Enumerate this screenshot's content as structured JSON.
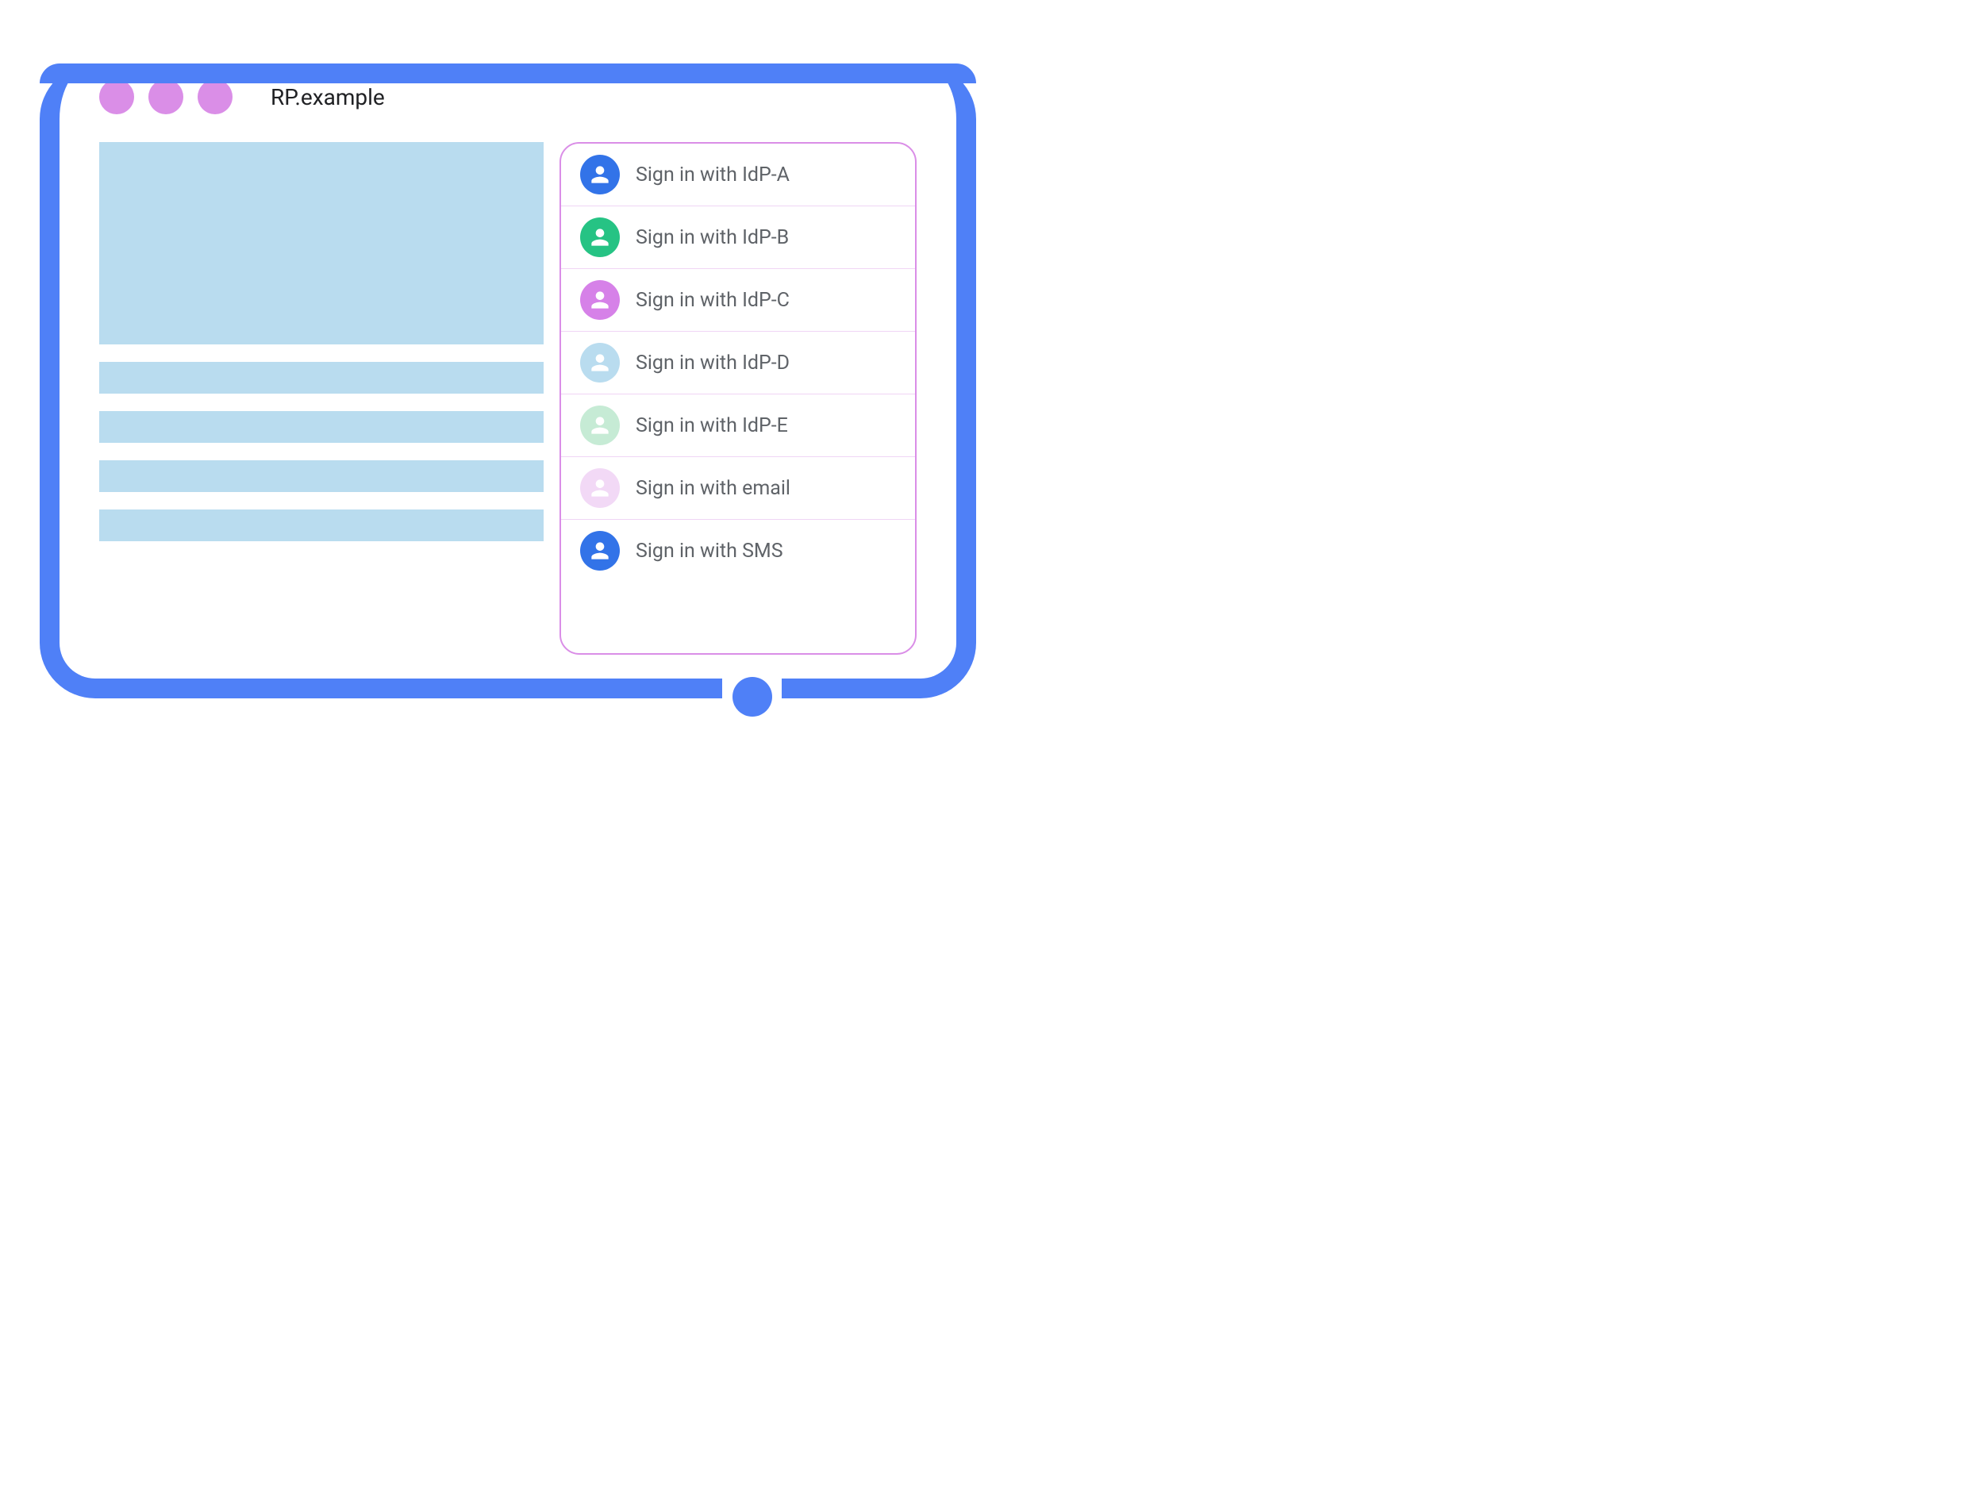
{
  "browser": {
    "address": "RP.example"
  },
  "signin_options": [
    {
      "label": "Sign in with IdP-A",
      "color": "#3273E8"
    },
    {
      "label": "Sign in with IdP-B",
      "color": "#26C384"
    },
    {
      "label": "Sign in with IdP-C",
      "color": "#D681E8"
    },
    {
      "label": "Sign in with IdP-D",
      "color": "#B9DCEF"
    },
    {
      "label": "Sign in with IdP-E",
      "color": "#C6EBD5"
    },
    {
      "label": "Sign in with email",
      "color": "#F2D9F6"
    },
    {
      "label": "Sign in with SMS",
      "color": "#3273E8"
    }
  ],
  "colors": {
    "frame": "#4F80F7",
    "traffic_light": "#DA8EE7",
    "content_block": "#B9DCEF",
    "panel_border": "#DA8EE7"
  }
}
